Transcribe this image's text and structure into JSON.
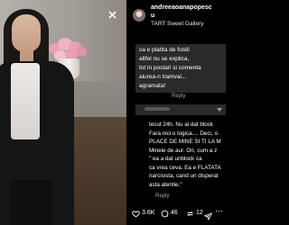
{
  "post": {
    "username": "andreeaoanapopescu",
    "username_line1": "andreeaoanapopesc",
    "username_line2": "u",
    "location": "TART Sweet Gallery"
  },
  "caption_lines": [
    "ca e platita de fostii",
    "altfel nu se explica,",
    "tot in postari si comenta",
    "aiurea-n tramvai...",
    "agramata!"
  ],
  "reply_label": "Reply",
  "comment_lines": [
    "tecut 24h. Nu ai dat block",
    "Fara nici o logica.... Deci, o",
    "PLACE DE MINE SI TI LA M",
    "Minele de aur. Ori, cum a z",
    "\" ea a dat unblock ca",
    "ca vrea ceva. Ea e FLATATA",
    "narcisista, cand un disperat",
    "asta atentie.\""
  ],
  "actions": {
    "likes": "3.6K",
    "comments": "46",
    "shares": "12"
  },
  "colors": {
    "background": "#000000",
    "comment_bubble": "#2a2a2a",
    "secondary_text": "#a8a8a8"
  },
  "icons": [
    "close-icon",
    "avatar",
    "heart-icon",
    "comment-icon",
    "repost-icon",
    "send-icon",
    "more-icon"
  ]
}
